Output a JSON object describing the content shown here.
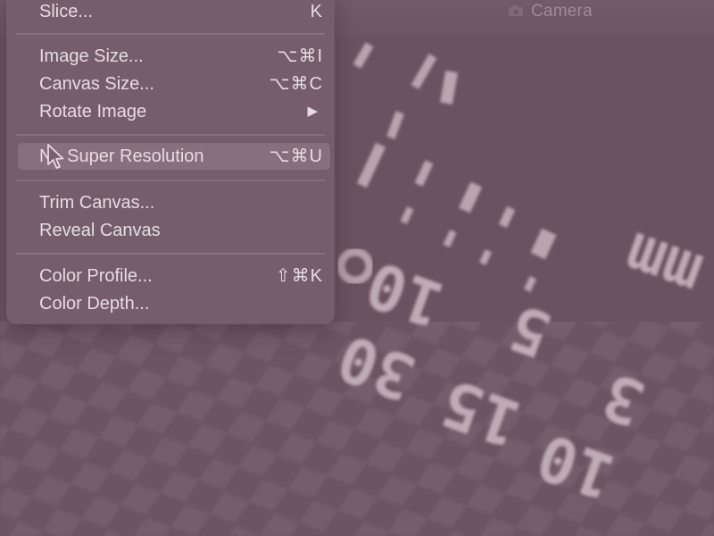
{
  "window": {
    "title": "Camera"
  },
  "menu": {
    "items": [
      {
        "label": "Slice...",
        "shortcut": "K"
      },
      {
        "label": "Image Size...",
        "shortcut": "⌥⌘I"
      },
      {
        "label": "Canvas Size...",
        "shortcut": "⌥⌘C"
      },
      {
        "label": "Rotate Image",
        "submenu_arrow": "▶"
      },
      {
        "label": "Super Resolution",
        "label_prefix": "N",
        "shortcut": "⌥⌘U",
        "highlighted": true
      },
      {
        "label": "Trim Canvas..."
      },
      {
        "label": "Reveal Canvas"
      },
      {
        "label": "Color Profile...",
        "shortcut": "⇧⌘K"
      },
      {
        "label": "Color Depth..."
      }
    ]
  },
  "background_photo": {
    "visible_numbers": [
      "30",
      "15",
      "10",
      "5",
      "3",
      "10",
      "mm"
    ]
  },
  "colors": {
    "background": "#6f5564",
    "menu_text": "#e8dbe2",
    "highlight": "#987e8d"
  }
}
